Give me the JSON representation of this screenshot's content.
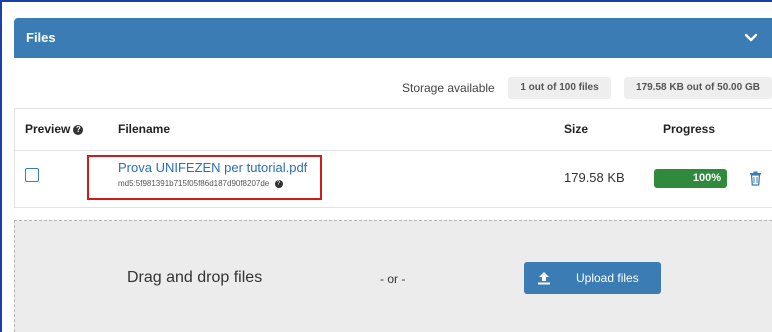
{
  "panel": {
    "title": "Files",
    "collapse_icon": "chevron-down-icon"
  },
  "storage": {
    "label": "Storage available",
    "files_quota": "1 out of 100 files",
    "size_quota": "179.58 KB out of 50.00 GB"
  },
  "table": {
    "headers": {
      "preview": "Preview",
      "filename": "Filename",
      "size": "Size",
      "progress": "Progress"
    },
    "help_glyph": "?",
    "rows": [
      {
        "filename": "Prova UNIFEZEN per tutorial.pdf",
        "checksum": "md5:5f981391b715f05f86d187d90f8207de",
        "size": "179.58 KB",
        "progress_label": "100%",
        "progress_fraction": 1.0,
        "preview_checked": false
      }
    ]
  },
  "dropzone": {
    "drag_text": "Drag and drop files",
    "or_text": "- or -",
    "upload_label": "Upload files",
    "upload_icon": "upload-icon"
  },
  "colors": {
    "header_blue": "#3b7cb5",
    "progress_green": "#2f8a3b",
    "highlight_red": "#d11a1a",
    "link_blue": "#2a6ebb"
  }
}
